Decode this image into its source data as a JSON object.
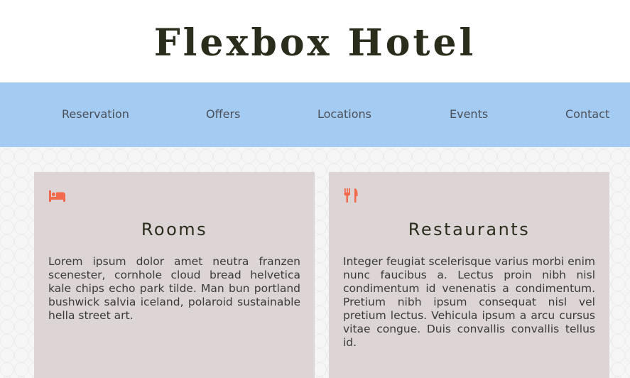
{
  "header": {
    "title": "Flexbox Hotel"
  },
  "nav": {
    "items": [
      {
        "label": "Reservation"
      },
      {
        "label": "Offers"
      },
      {
        "label": "Locations"
      },
      {
        "label": "Events"
      },
      {
        "label": "Contact"
      }
    ]
  },
  "cards": [
    {
      "icon": "bed-icon",
      "title": "Rooms",
      "text": "Lorem ipsum dolor amet neutra franzen scenester, cornhole cloud bread helvetica kale chips echo park tilde. Man bun portland bushwick salvia iceland, polaroid sustainable hella street art."
    },
    {
      "icon": "fork-knife-icon",
      "title": "Restaurants",
      "text": "Integer feugiat scelerisque varius morbi enim nunc faucibus a. Lectus proin nibh nisl condimentum id venenatis a condimentum. Pretium nibh ipsum consequat nisl vel pretium lectus. Vehicula ipsum a arcu cursus vitae congue. Duis convallis convallis tellus id."
    }
  ],
  "colors": {
    "nav_bg": "#a4cbf1",
    "card_bg": "#ddd4d5",
    "accent_icon": "#f26a4b",
    "title_text": "#2a2d1c"
  }
}
